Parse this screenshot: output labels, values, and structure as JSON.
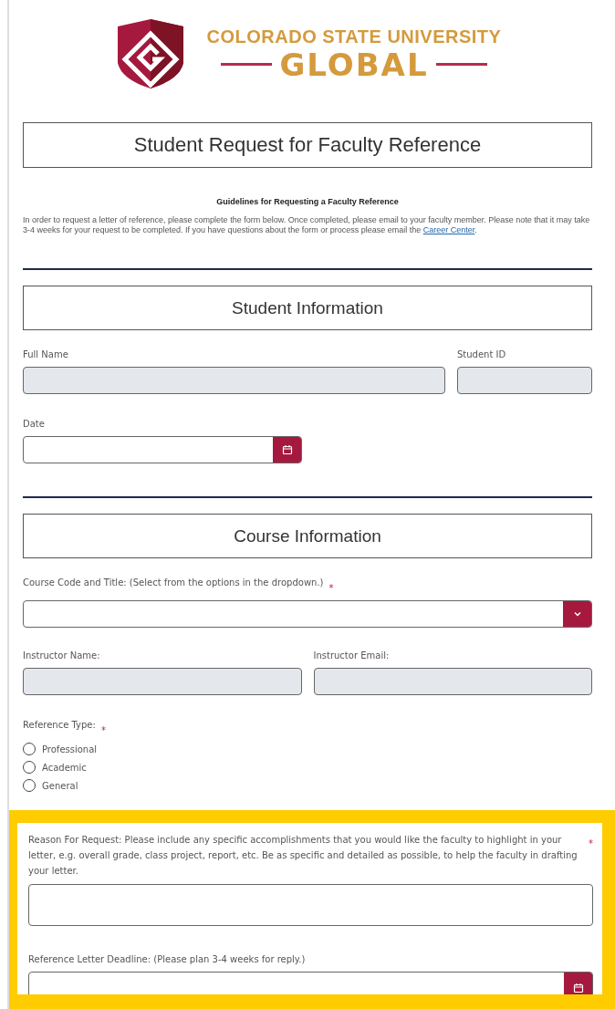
{
  "logo": {
    "line1": "COLORADO STATE UNIVERSITY",
    "line2": "GLOBAL"
  },
  "title": "Student Request for Faculty Reference",
  "guidelines": {
    "heading": "Guidelines for Requesting a Faculty Reference",
    "text": "In order to request a letter of reference, please complete the form below. Once completed, please email to your faculty member. Please note that it may take 3-4 weeks for your request to be completed. If you have questions about the form or process please email the ",
    "link": "Career Center",
    "after": "."
  },
  "student": {
    "heading": "Student Information",
    "full_name": {
      "label": "Full Name",
      "kind": "readonly"
    },
    "student_id": {
      "label": "Student ID",
      "kind": "readonly"
    },
    "date": {
      "label": "Date",
      "kind": "date"
    }
  },
  "course": {
    "heading": "Course Information",
    "course_code": {
      "label": "Course Code and Title: (Select from the options in the dropdown.)",
      "required_mark": "*",
      "kind": "select"
    },
    "instructor_name": {
      "label": "Instructor Name:",
      "kind": "readonly"
    },
    "instructor_email": {
      "label": "Instructor Email:",
      "kind": "readonly"
    },
    "reference_type": {
      "label": "Reference Type:",
      "required_mark": "*",
      "options": [
        {
          "label": "Professional",
          "selected": false
        },
        {
          "label": "Academic",
          "selected": false
        },
        {
          "label": "General",
          "selected": false
        }
      ]
    }
  },
  "highlight": {
    "reason": {
      "label": "Reason For Request: Please include any specific accomplishments that you would like the faculty to highlight in your letter, e.g. overall grade, class project, report, etc. Be as specific and detailed as possible, to help the faculty in drafting your letter.",
      "required_mark": "*",
      "kind": "textarea"
    },
    "deadline": {
      "label": "Reference Letter Deadline: (Please plan 3-4 weeks for reply.)",
      "kind": "date"
    }
  }
}
